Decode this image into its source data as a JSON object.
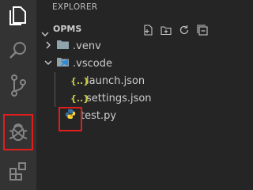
{
  "activity_bar": {
    "items": [
      {
        "name": "explorer",
        "icon": "files-icon"
      },
      {
        "name": "search",
        "icon": "search-icon"
      },
      {
        "name": "source-control",
        "icon": "source-control-icon"
      },
      {
        "name": "run-and-debug",
        "icon": "debug-icon",
        "highlighted": true
      },
      {
        "name": "extensions",
        "icon": "extensions-icon"
      }
    ]
  },
  "explorer": {
    "title": "EXPLORER",
    "section_title": "OPMS",
    "actions": [
      "new-file-icon",
      "new-folder-icon",
      "refresh-icon",
      "collapse-all-icon"
    ],
    "tree": [
      {
        "label": ".venv",
        "type": "folder",
        "expanded": false,
        "depth": 1
      },
      {
        "label": ".vscode",
        "type": "folder",
        "expanded": true,
        "depth": 1
      },
      {
        "label": "launch.json",
        "type": "json",
        "depth": 2
      },
      {
        "label": "settings.json",
        "type": "json",
        "depth": 2
      },
      {
        "label": "test.py",
        "type": "python",
        "depth": 1,
        "highlighted": true
      }
    ]
  },
  "colors": {
    "highlight": "#e01e1e",
    "json_icon": "#cbcb41",
    "folder": "#90a4ae",
    "python_blue": "#3572a5",
    "python_yellow": "#ffd43b"
  }
}
